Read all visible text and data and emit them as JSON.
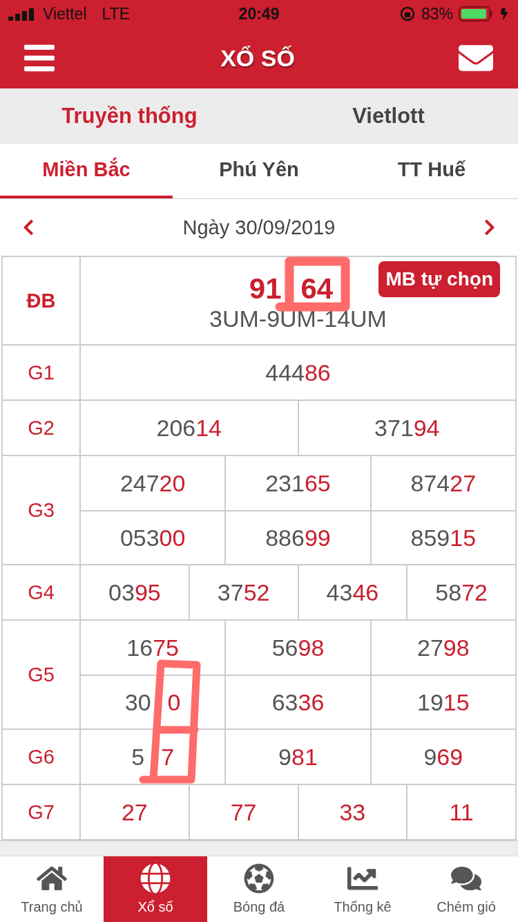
{
  "status_bar": {
    "carrier": "Viettel",
    "network": "LTE",
    "time": "20:49",
    "battery": "83%"
  },
  "header": {
    "title": "XỔ SỐ"
  },
  "top_tabs": [
    {
      "label": "Truyền thống",
      "selected": true
    },
    {
      "label": "Vietlott",
      "selected": false
    }
  ],
  "region_tabs": [
    {
      "label": "Miền Bắc",
      "selected": true
    },
    {
      "label": "Phú Yên",
      "selected": false
    },
    {
      "label": "TT Huế",
      "selected": false
    }
  ],
  "date": "Ngày 30/09/2019",
  "special": {
    "label": "ĐB",
    "number": "91",
    "number_end": "64",
    "covered": true,
    "codes": "3UM-9UM-14UM",
    "button": "MB tự chọn"
  },
  "prizes": [
    {
      "label": "G1",
      "rows": [
        [
          {
            "head": "444",
            "tail": "86"
          }
        ]
      ]
    },
    {
      "label": "G2",
      "rows": [
        [
          {
            "head": "206",
            "tail": "14"
          },
          {
            "head": "371",
            "tail": "94"
          }
        ]
      ]
    },
    {
      "label": "G3",
      "rows": [
        [
          {
            "head": "247",
            "tail": "20"
          },
          {
            "head": "231",
            "tail": "65"
          },
          {
            "head": "874",
            "tail": "27"
          }
        ],
        [
          {
            "head": "053",
            "tail": "00"
          },
          {
            "head": "886",
            "tail": "99"
          },
          {
            "head": "859",
            "tail": "15"
          }
        ]
      ]
    },
    {
      "label": "G4",
      "rows": [
        [
          {
            "head": "03",
            "tail": "95"
          },
          {
            "head": "37",
            "tail": "52"
          },
          {
            "head": "43",
            "tail": "46"
          },
          {
            "head": "58",
            "tail": "72"
          }
        ]
      ]
    },
    {
      "label": "G5",
      "rows": [
        [
          {
            "head": "16",
            "tail": "75"
          },
          {
            "head": "56",
            "tail": "98"
          },
          {
            "head": "27",
            "tail": "98"
          }
        ],
        [
          {
            "head": "30",
            "tail": "0",
            "covered": true,
            "scribble": true
          },
          {
            "head": "63",
            "tail": "36"
          },
          {
            "head": "19",
            "tail": "15"
          }
        ]
      ]
    },
    {
      "label": "G6",
      "rows": [
        [
          {
            "head": "5",
            "tail": "7",
            "covered": true
          },
          {
            "head": "9",
            "tail": "81"
          },
          {
            "head": "9",
            "tail": "69"
          }
        ]
      ]
    },
    {
      "label": "G7",
      "rows": [
        [
          {
            "tail": "27"
          },
          {
            "tail": "77"
          },
          {
            "tail": "33"
          },
          {
            "tail": "11"
          }
        ]
      ]
    }
  ],
  "bottom_nav": [
    {
      "label": "Trang chủ",
      "selected": false
    },
    {
      "label": "Xổ số",
      "selected": true
    },
    {
      "label": "Bóng đá",
      "selected": false
    },
    {
      "label": "Thống kê",
      "selected": false
    },
    {
      "label": "Chém gió",
      "selected": false
    }
  ]
}
